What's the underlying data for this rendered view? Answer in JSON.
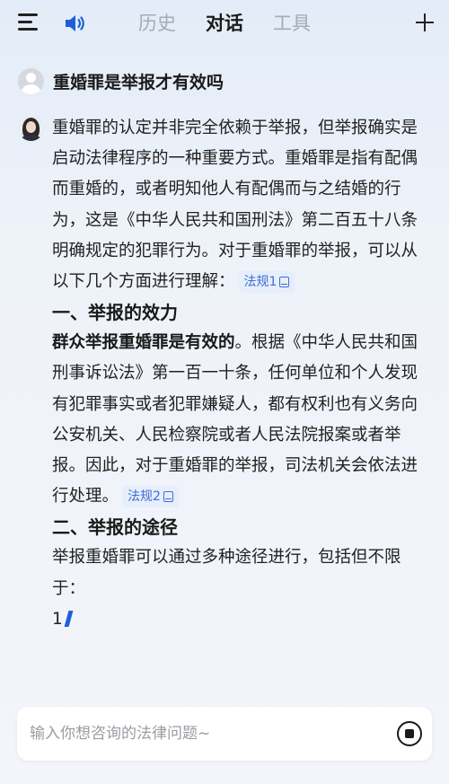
{
  "header": {
    "tabs": [
      {
        "label": "历史"
      },
      {
        "label": "对话"
      },
      {
        "label": "工具"
      }
    ],
    "active_tab": "对话"
  },
  "conversation": {
    "question": "重婚罪是举报才有效吗",
    "answer": {
      "intro": "重婚罪的认定并非完全依赖于举报，但举报确实是启动法律程序的一种重要方式。重婚罪是指有配偶而重婚的，或者明知他人有配偶而与之结婚的行为，这是《中华人民共和国刑法》第二百五十八条明确规定的犯罪行为。对于重婚罪的举报，可以从以下几个方面进行理解：",
      "cite1": "法规1",
      "section1_title": "一、举报的效力",
      "section1_bold": "群众举报重婚罪是有效的",
      "section1_text": "。根据《中华人民共和国刑事诉讼法》第一百一十条，任何单位和个人发现有犯罪事实或者犯罪嫌疑人，都有权利也有义务向公安机关、人民检察院或者人民法院报案或者举报。因此，对于重婚罪的举报，司法机关会依法进行处理。",
      "cite2": "法规2",
      "section2_title": "二、举报的途径",
      "section2_text": "举报重婚罪可以通过多种途径进行，包括但不限于：",
      "list_start": "1"
    }
  },
  "input": {
    "placeholder": "输入你想咨询的法律问题~",
    "value": ""
  },
  "icons": {
    "menu": "menu-icon",
    "speaker": "speaker-icon",
    "new_chat": "plus-icon",
    "stop": "stop-icon"
  },
  "colors": {
    "accent": "#3d6fd6",
    "speaker": "#1f5fd6"
  }
}
